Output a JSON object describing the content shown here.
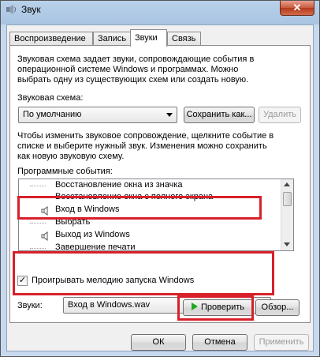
{
  "window": {
    "title": "Звук",
    "close_label": "✕"
  },
  "tabs": [
    {
      "label": "Воспроизведение"
    },
    {
      "label": "Запись"
    },
    {
      "label": "Звуки"
    },
    {
      "label": "Связь"
    }
  ],
  "scheme": {
    "description": "Звуковая схема задает звуки, сопровождающие события в операционной системе Windows и программах. Можно выбрать одну из существующих схем или создать новую.",
    "desc_lines": [
      "Звуковая схема задает звуки, сопровождающие события в",
      "операционной системе Windows и программах. Можно",
      "выбрать одну из существующих схем или создать новую."
    ],
    "label": "Звуковая схема:",
    "selected": "По умолчанию",
    "save_as_label": "Сохранить как...",
    "delete_label": "Удалить"
  },
  "events": {
    "hint_lines": [
      "Чтобы изменить звуковое сопровождение, щелкните событие в",
      "списке и выберите нужный звук. Изменения можно сохранить",
      "как новую звуковую схему."
    ],
    "label": "Программные события:",
    "items": [
      {
        "label": "Восстановление окна из значка",
        "has_sound": false
      },
      {
        "label": "Восстановление окна с полного экрана",
        "has_sound": false
      },
      {
        "label": "Вход в Windows",
        "has_sound": true
      },
      {
        "label": "Выбрать",
        "has_sound": false
      },
      {
        "label": "Выход из Windows",
        "has_sound": true
      },
      {
        "label": "Завершение печати",
        "has_sound": false
      }
    ]
  },
  "startup": {
    "label": "Проигрывать мелодию запуска Windows",
    "checked": true
  },
  "sounds": {
    "label": "Звуки:",
    "selected": "Вход в Windows.wav",
    "test_label": "Проверить",
    "browse_label": "Обзор..."
  },
  "footer": {
    "ok_label": "ОК",
    "cancel_label": "Отмена",
    "apply_label": "Применить"
  },
  "colors": {
    "highlight": "#d8202a",
    "play": "#1ea81e"
  }
}
